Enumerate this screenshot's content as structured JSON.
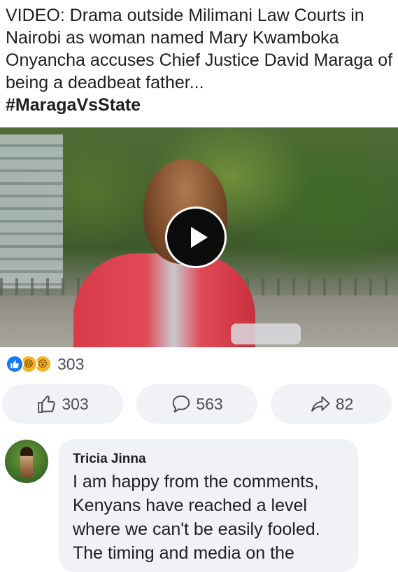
{
  "post": {
    "text": "VIDEO: Drama outside Milimani Law Courts in Nairobi as woman named Mary Kwamboka Onyancha accuses Chief Justice David Maraga of being a deadbeat father...",
    "hashtag": "#MaragaVsState"
  },
  "reactions": {
    "icons": [
      "like-icon",
      "haha-icon",
      "wow-icon"
    ],
    "count": "303"
  },
  "actions": {
    "like_count": "303",
    "comment_count": "563",
    "share_count": "82"
  },
  "comment": {
    "author": "Tricia Jinna",
    "text": "I am happy from the comments, Kenyans have reached a level where we can't be easily fooled. The timing and media on the"
  },
  "colors": {
    "like_blue": "#1877f2",
    "reaction_yellow": "#f7b125",
    "button_bg": "#f0f2f5",
    "text_secondary": "#4b4f56"
  }
}
